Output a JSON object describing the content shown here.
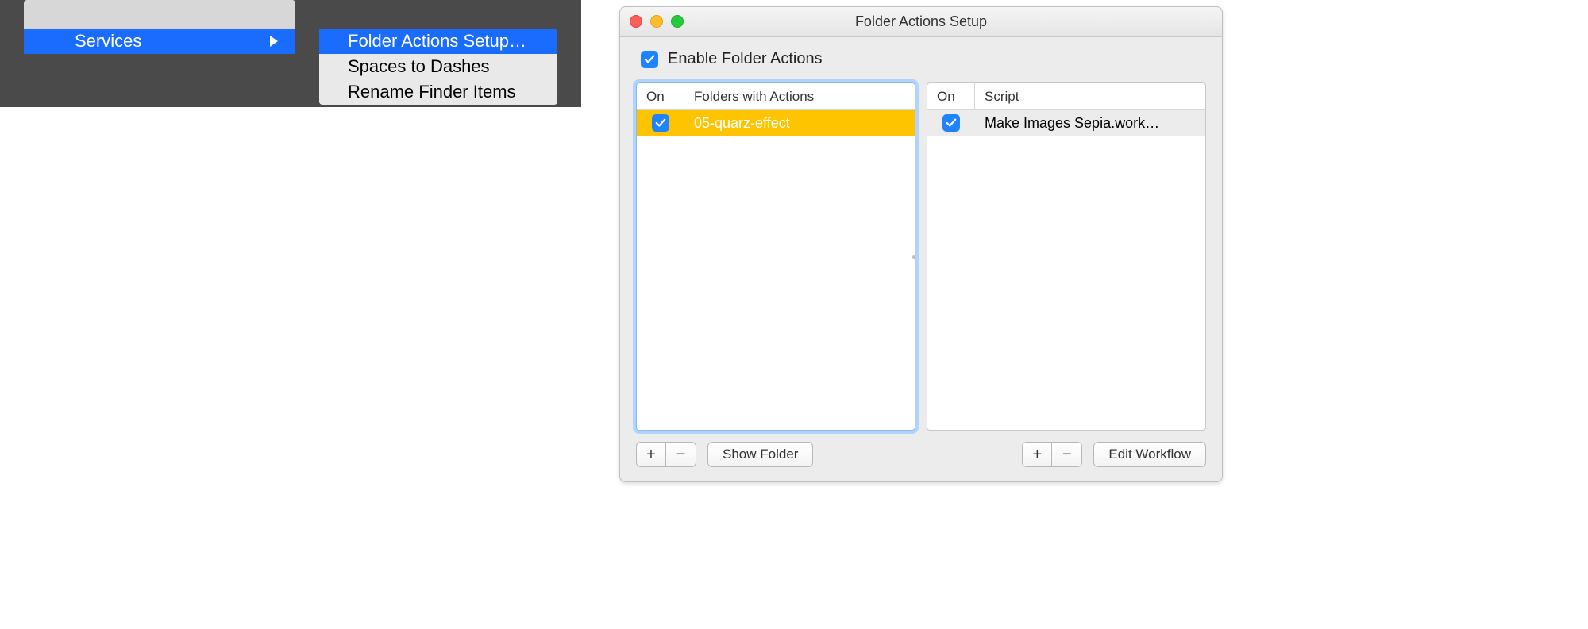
{
  "context_menu": {
    "parent_item": "Services",
    "submenu": [
      {
        "label": "Folder Actions Setup…",
        "highlighted": true
      },
      {
        "label": "Spaces to Dashes",
        "highlighted": false
      },
      {
        "label": "Rename Finder Items",
        "highlighted": false
      }
    ]
  },
  "window": {
    "title": "Folder Actions Setup",
    "enable_label": "Enable Folder Actions",
    "enable_checked": true,
    "folders": {
      "col_on": "On",
      "col_name": "Folders with Actions",
      "rows": [
        {
          "on": true,
          "name": "05-quarz-effect",
          "selected": true
        }
      ],
      "add_label": "+",
      "remove_label": "−",
      "show_label": "Show Folder"
    },
    "scripts": {
      "col_on": "On",
      "col_name": "Script",
      "rows": [
        {
          "on": true,
          "name": "Make Images Sepia.work…",
          "selected": true
        }
      ],
      "add_label": "+",
      "remove_label": "−",
      "edit_label": "Edit Workflow"
    }
  }
}
